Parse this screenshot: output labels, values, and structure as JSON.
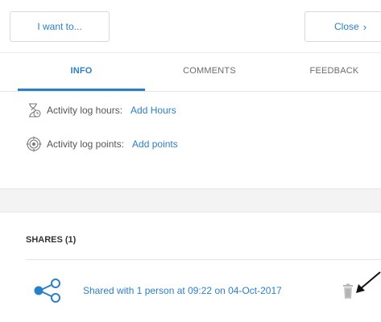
{
  "header": {
    "i_want_label": "I want to...",
    "close_label": "Close",
    "close_icon": "chevron-right-icon"
  },
  "tabs": [
    {
      "label": "INFO",
      "active": true
    },
    {
      "label": "COMMENTS",
      "active": false
    },
    {
      "label": "FEEDBACK",
      "active": false
    }
  ],
  "info": {
    "hours": {
      "icon": "hourglass-icon",
      "label": "Activity log hours:",
      "link": "Add Hours"
    },
    "points": {
      "icon": "target-icon",
      "label": "Activity log points:",
      "link": "Add points"
    }
  },
  "shares": {
    "heading": "SHARES (1)",
    "items": [
      {
        "icon": "share-icon",
        "text": "Shared with 1 person at 09:22 on 04-Oct-2017",
        "action_icon": "trash-icon"
      }
    ]
  },
  "colors": {
    "accent": "#2a7fc9",
    "text": "#333333",
    "band": "#f3f3f3"
  }
}
